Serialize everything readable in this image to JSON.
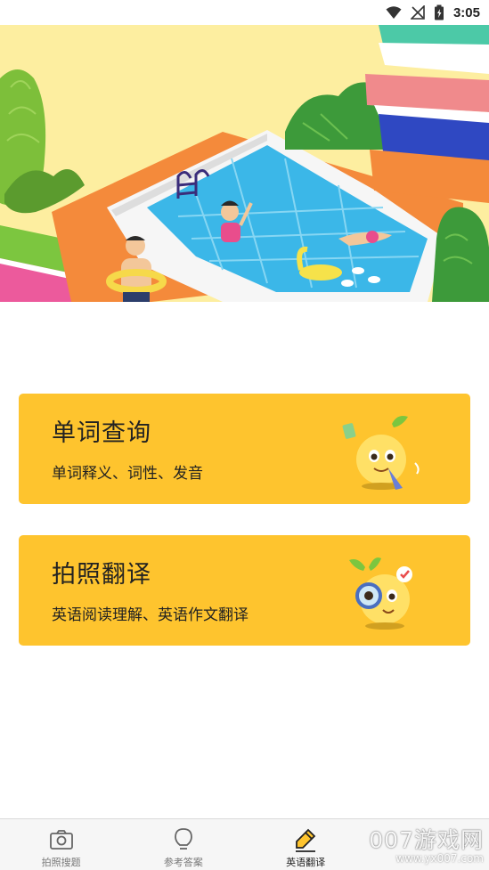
{
  "status_bar": {
    "time": "3:05",
    "icons": [
      "wifi-icon",
      "no-signal-icon",
      "battery-icon"
    ]
  },
  "banner": {
    "illustration": "open-book-swimming-pool-illustration"
  },
  "cards": [
    {
      "title": "单词查询",
      "subtitle": "单词释义、词性、发音",
      "mascot": "mascot-with-pencil-icon"
    },
    {
      "title": "拍照翻译",
      "subtitle": "英语阅读理解、英语作文翻译",
      "mascot": "mascot-with-magnifier-icon"
    }
  ],
  "tabbar": {
    "active_index": 2,
    "items": [
      {
        "label": "拍照搜题",
        "icon": "camera-icon"
      },
      {
        "label": "参考答案",
        "icon": "lightbulb-icon"
      },
      {
        "label": "英语翻译",
        "icon": "pencil-icon"
      },
      {
        "label": "",
        "icon": ""
      }
    ]
  },
  "watermark": {
    "main": "007游戏网",
    "sub": "www.yx007.com"
  },
  "colors": {
    "accent": "#fec42e",
    "banner_bg": "#fdeea0",
    "tabbar_bg": "#f6f6f6"
  }
}
